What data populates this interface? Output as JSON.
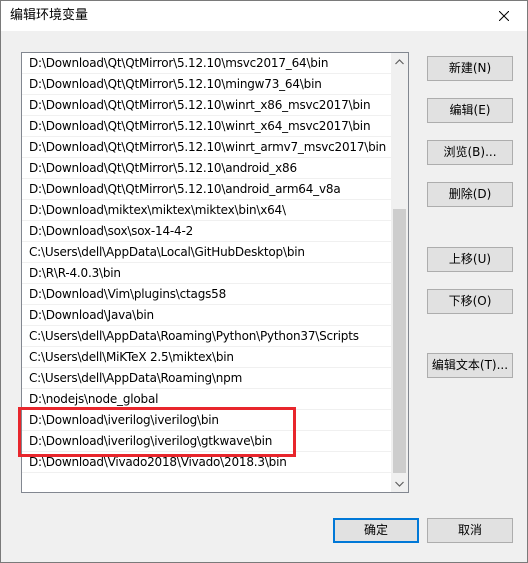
{
  "window": {
    "title": "编辑环境变量"
  },
  "path_list": {
    "items": [
      "D:\\Download\\Qt\\QtMirror\\5.12.10\\msvc2017_64\\bin",
      "D:\\Download\\Qt\\QtMirror\\5.12.10\\mingw73_64\\bin",
      "D:\\Download\\Qt\\QtMirror\\5.12.10\\winrt_x86_msvc2017\\bin",
      "D:\\Download\\Qt\\QtMirror\\5.12.10\\winrt_x64_msvc2017\\bin",
      "D:\\Download\\Qt\\QtMirror\\5.12.10\\winrt_armv7_msvc2017\\bin",
      "D:\\Download\\Qt\\QtMirror\\5.12.10\\android_x86",
      "D:\\Download\\Qt\\QtMirror\\5.12.10\\android_arm64_v8a",
      "D:\\Download\\miktex\\miktex\\miktex\\bin\\x64\\",
      "D:\\Download\\sox\\sox-14-4-2",
      "C:\\Users\\dell\\AppData\\Local\\GitHubDesktop\\bin",
      "D:\\R\\R-4.0.3\\bin",
      "D:\\Download\\Vim\\plugins\\ctags58",
      "D:\\Download\\Java\\bin",
      "C:\\Users\\dell\\AppData\\Roaming\\Python\\Python37\\Scripts",
      "C:\\Users\\dell\\MiKTeX 2.5\\miktex\\bin",
      "C:\\Users\\dell\\AppData\\Roaming\\npm",
      "D:\\nodejs\\node_global",
      "D:\\Download\\iverilog\\iverilog\\bin",
      "D:\\Download\\iverilog\\iverilog\\gtkwave\\bin",
      "D:\\Download\\Vivado2018\\Vivado\\2018.3\\bin"
    ]
  },
  "buttons": {
    "new": "新建(N)",
    "edit": "编辑(E)",
    "browse": "浏览(B)...",
    "delete": "删除(D)",
    "move_up": "上移(U)",
    "move_down": "下移(O)",
    "edit_text": "编辑文本(T)...",
    "ok": "确定",
    "cancel": "取消"
  },
  "colors": {
    "highlight": "#e8262c",
    "accent": "#0078d7"
  }
}
